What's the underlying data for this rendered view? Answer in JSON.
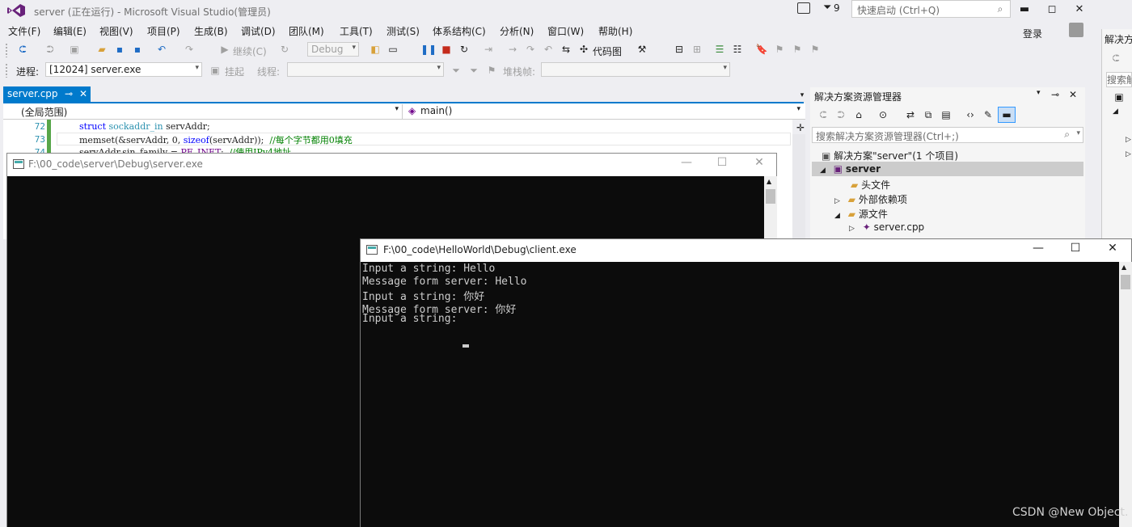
{
  "app": {
    "window_title": "server (正在运行) - Microsoft Visual Studio(管理员)",
    "notification_count": "9",
    "quick_launch_placeholder": "快速启动 (Ctrl+Q)",
    "login": "登录"
  },
  "menu": [
    "文件(F)",
    "编辑(E)",
    "视图(V)",
    "项目(P)",
    "生成(B)",
    "调试(D)",
    "团队(M)",
    "工具(T)",
    "测试(S)",
    "体系结构(C)",
    "分析(N)",
    "窗口(W)",
    "帮助(H)"
  ],
  "toolbar": {
    "continue_label": "继续(C)",
    "config": "Debug",
    "code_map_label": "代码图",
    "process_label": "进程:",
    "process_value": "[12024] server.exe",
    "suspend_label": "挂起",
    "thread_label": "线程:",
    "stackframe_label": "堆栈帧:"
  },
  "editor": {
    "tab_name": "server.cpp",
    "scope": "(全局范围)",
    "function": "main()",
    "line_numbers": [
      "72",
      "73",
      "74"
    ]
  },
  "console_server": {
    "title": "F:\\00_code\\server\\Debug\\server.exe"
  },
  "console_client": {
    "title": "F:\\00_code\\HelloWorld\\Debug\\client.exe",
    "lines": [
      "Input a string: Hello",
      "Message form server: Hello",
      "Input a string: 你好",
      "Message form server: 你好",
      "Input a string: "
    ]
  },
  "solution_explorer": {
    "title": "解决方案资源管理器",
    "search_placeholder": "搜索解决方案资源管理器(Ctrl+;)",
    "solution": "解决方案\"server\"(1 个项目)",
    "project": "server",
    "items": [
      "头文件",
      "外部依赖项",
      "源文件",
      "server.cpp"
    ]
  },
  "right_panel": {
    "title": "解决方",
    "search": "搜索解"
  },
  "watermark": "CSDN @New Object."
}
